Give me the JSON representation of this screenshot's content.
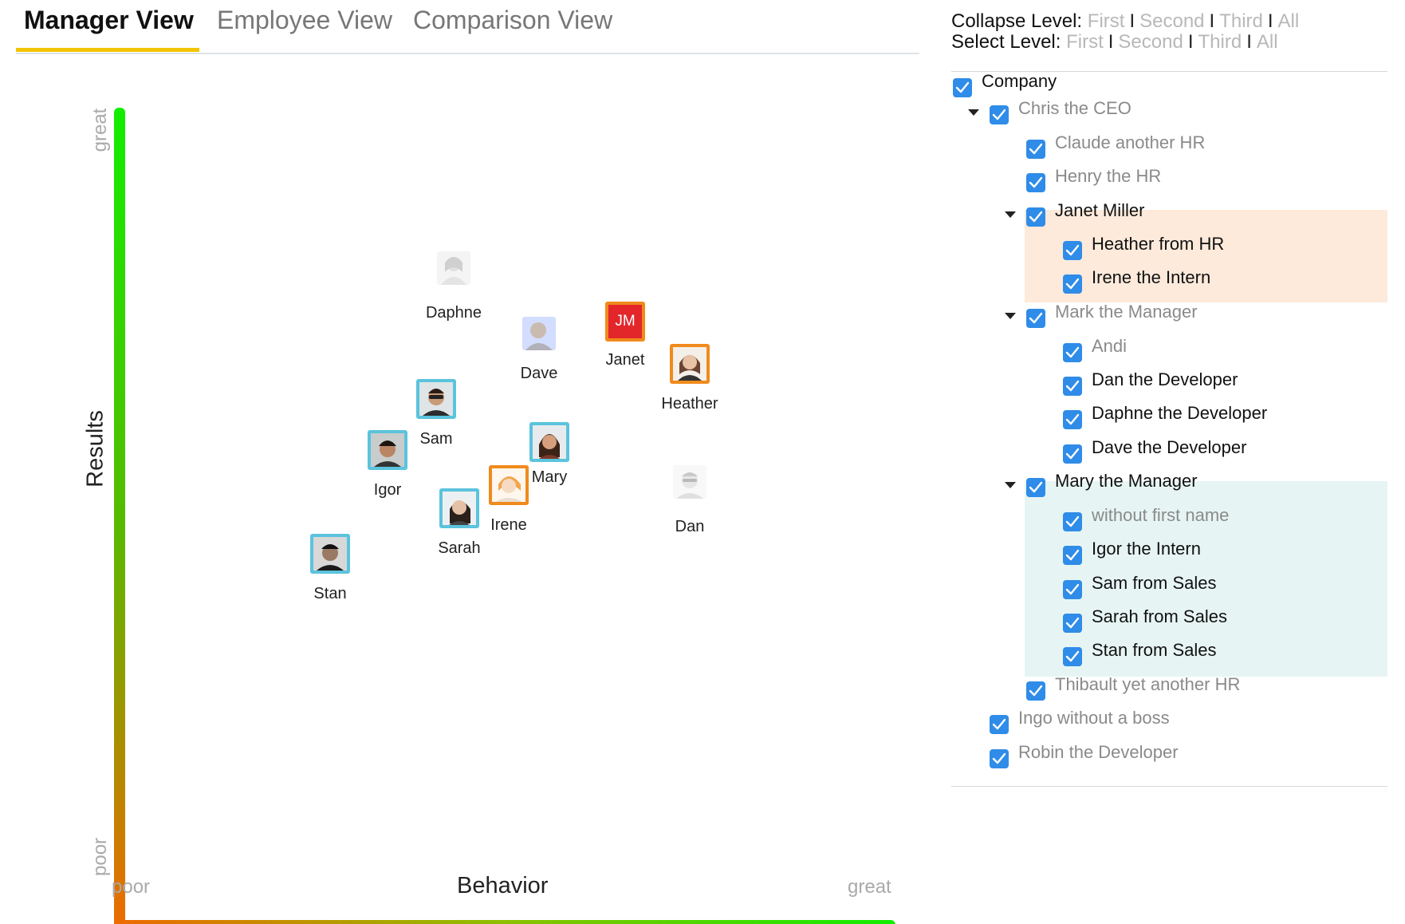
{
  "tabs": [
    {
      "label": "Manager View",
      "active": true
    },
    {
      "label": "Employee View",
      "active": false
    },
    {
      "label": "Comparison View",
      "active": false
    }
  ],
  "chart": {
    "y_title": "Results",
    "x_title": "Behavior",
    "y_low": "poor",
    "y_high": "great",
    "x_low": "poor",
    "x_high": "great",
    "gradient_colors": {
      "good": "#11ee00",
      "bad": "#ee6a00"
    }
  },
  "people": [
    {
      "name": "Daphne",
      "style": "faded"
    },
    {
      "name": "Dave",
      "style": "faded"
    },
    {
      "name": "Janet",
      "style": "initials",
      "initials": "JM"
    },
    {
      "name": "Heather",
      "style": "orange"
    },
    {
      "name": "Sam",
      "style": "bordered"
    },
    {
      "name": "Igor",
      "style": "bordered"
    },
    {
      "name": "Mary",
      "style": "bordered"
    },
    {
      "name": "Irene",
      "style": "orange"
    },
    {
      "name": "Sarah",
      "style": "bordered"
    },
    {
      "name": "Dan",
      "style": "faded"
    },
    {
      "name": "Stan",
      "style": "bordered"
    }
  ],
  "levels": {
    "collapse_label": "Collapse Level:",
    "select_label": "Select Level:",
    "options": [
      "First",
      "Second",
      "Third",
      "All"
    ]
  },
  "tree": [
    {
      "label": "Company",
      "depth": 0,
      "caret": false,
      "tone": "dark"
    },
    {
      "label": "Chris the CEO",
      "depth": 1,
      "caret": true,
      "tone": "grey"
    },
    {
      "label": "Claude another HR",
      "depth": 2,
      "caret": false,
      "tone": "grey"
    },
    {
      "label": "Henry the HR",
      "depth": 2,
      "caret": false,
      "tone": "grey"
    },
    {
      "label": "Janet Miller",
      "depth": 2,
      "caret": true,
      "tone": "dark"
    },
    {
      "label": "Heather from HR",
      "depth": 3,
      "caret": false,
      "tone": "dark"
    },
    {
      "label": "Irene the Intern",
      "depth": 3,
      "caret": false,
      "tone": "dark"
    },
    {
      "label": "Mark the Manager",
      "depth": 2,
      "caret": true,
      "tone": "grey"
    },
    {
      "label": "Andi",
      "depth": 3,
      "caret": false,
      "tone": "grey"
    },
    {
      "label": "Dan the Developer",
      "depth": 3,
      "caret": false,
      "tone": "dark"
    },
    {
      "label": "Daphne the Developer",
      "depth": 3,
      "caret": false,
      "tone": "dark"
    },
    {
      "label": "Dave the Developer",
      "depth": 3,
      "caret": false,
      "tone": "dark"
    },
    {
      "label": "Mary the Manager",
      "depth": 2,
      "caret": true,
      "tone": "dark"
    },
    {
      "label": "without first name",
      "depth": 3,
      "caret": false,
      "tone": "grey"
    },
    {
      "label": "Igor the Intern",
      "depth": 3,
      "caret": false,
      "tone": "dark"
    },
    {
      "label": "Sam from Sales",
      "depth": 3,
      "caret": false,
      "tone": "dark"
    },
    {
      "label": "Sarah from Sales",
      "depth": 3,
      "caret": false,
      "tone": "dark"
    },
    {
      "label": "Stan from Sales",
      "depth": 3,
      "caret": false,
      "tone": "dark"
    },
    {
      "label": "Thibault yet another HR",
      "depth": 2,
      "caret": false,
      "tone": "grey"
    },
    {
      "label": "Ingo without a boss",
      "depth": 1,
      "caret": false,
      "tone": "grey"
    },
    {
      "label": "Robin the Developer",
      "depth": 1,
      "caret": false,
      "tone": "grey"
    }
  ],
  "highlight_colors": {
    "janet_group": "#fdeadb",
    "mary_group": "#e6f5f3"
  }
}
